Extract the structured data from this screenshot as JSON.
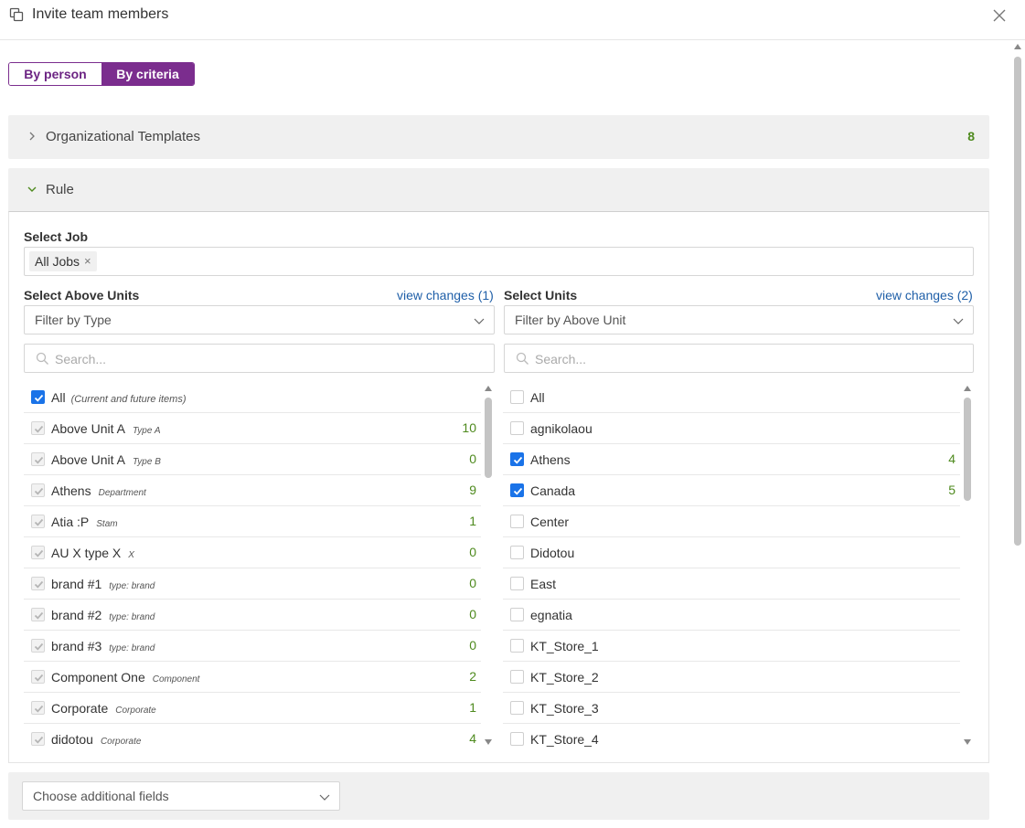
{
  "header": {
    "title": "Invite team members"
  },
  "mode_toggle": {
    "by_person": "By person",
    "by_criteria": "By criteria"
  },
  "org_templates": {
    "label": "Organizational Templates",
    "count": "8"
  },
  "rule": {
    "label": "Rule",
    "select_job": {
      "label": "Select Job",
      "chip": "All Jobs"
    },
    "above_units": {
      "label": "Select Above Units",
      "view_changes": "view changes (1)",
      "filter_placeholder": "Filter by Type",
      "search_placeholder": "Search...",
      "all_label": "All",
      "all_note": "(Current and future items)",
      "items": [
        {
          "name": "Above Unit A",
          "type": "Type A",
          "count": "10"
        },
        {
          "name": "Above Unit A",
          "type": "Type B",
          "count": "0"
        },
        {
          "name": "Athens",
          "type": "Department",
          "count": "9"
        },
        {
          "name": "Atia :P",
          "type": "Stam",
          "count": "1"
        },
        {
          "name": "AU X type X",
          "type": "X",
          "count": "0"
        },
        {
          "name": "brand #1",
          "type": "type: brand",
          "count": "0"
        },
        {
          "name": "brand #2",
          "type": "type: brand",
          "count": "0"
        },
        {
          "name": "brand #3",
          "type": "type: brand",
          "count": "0"
        },
        {
          "name": "Component One",
          "type": "Component",
          "count": "2"
        },
        {
          "name": "Corporate",
          "type": "Corporate",
          "count": "1"
        },
        {
          "name": "didotou",
          "type": "Corporate",
          "count": "4"
        }
      ]
    },
    "units": {
      "label": "Select Units",
      "view_changes": "view changes (2)",
      "filter_placeholder": "Filter by Above Unit",
      "search_placeholder": "Search...",
      "all_label": "All",
      "items": [
        {
          "name": "agnikolaou",
          "checked": false,
          "count": ""
        },
        {
          "name": "Athens",
          "checked": true,
          "count": "4"
        },
        {
          "name": "Canada",
          "checked": true,
          "count": "5"
        },
        {
          "name": "Center",
          "checked": false,
          "count": ""
        },
        {
          "name": "Didotou",
          "checked": false,
          "count": ""
        },
        {
          "name": "East",
          "checked": false,
          "count": ""
        },
        {
          "name": "egnatia",
          "checked": false,
          "count": ""
        },
        {
          "name": "KT_Store_1",
          "checked": false,
          "count": ""
        },
        {
          "name": "KT_Store_2",
          "checked": false,
          "count": ""
        },
        {
          "name": "KT_Store_3",
          "checked": false,
          "count": ""
        },
        {
          "name": "KT_Store_4",
          "checked": false,
          "count": ""
        }
      ]
    }
  },
  "additional_fields": {
    "placeholder": "Choose additional fields"
  },
  "colors": {
    "accent": "#7b2d8e",
    "checkbox": "#1a73e8",
    "count": "#4e8a1e",
    "link": "#1f5fa8"
  }
}
